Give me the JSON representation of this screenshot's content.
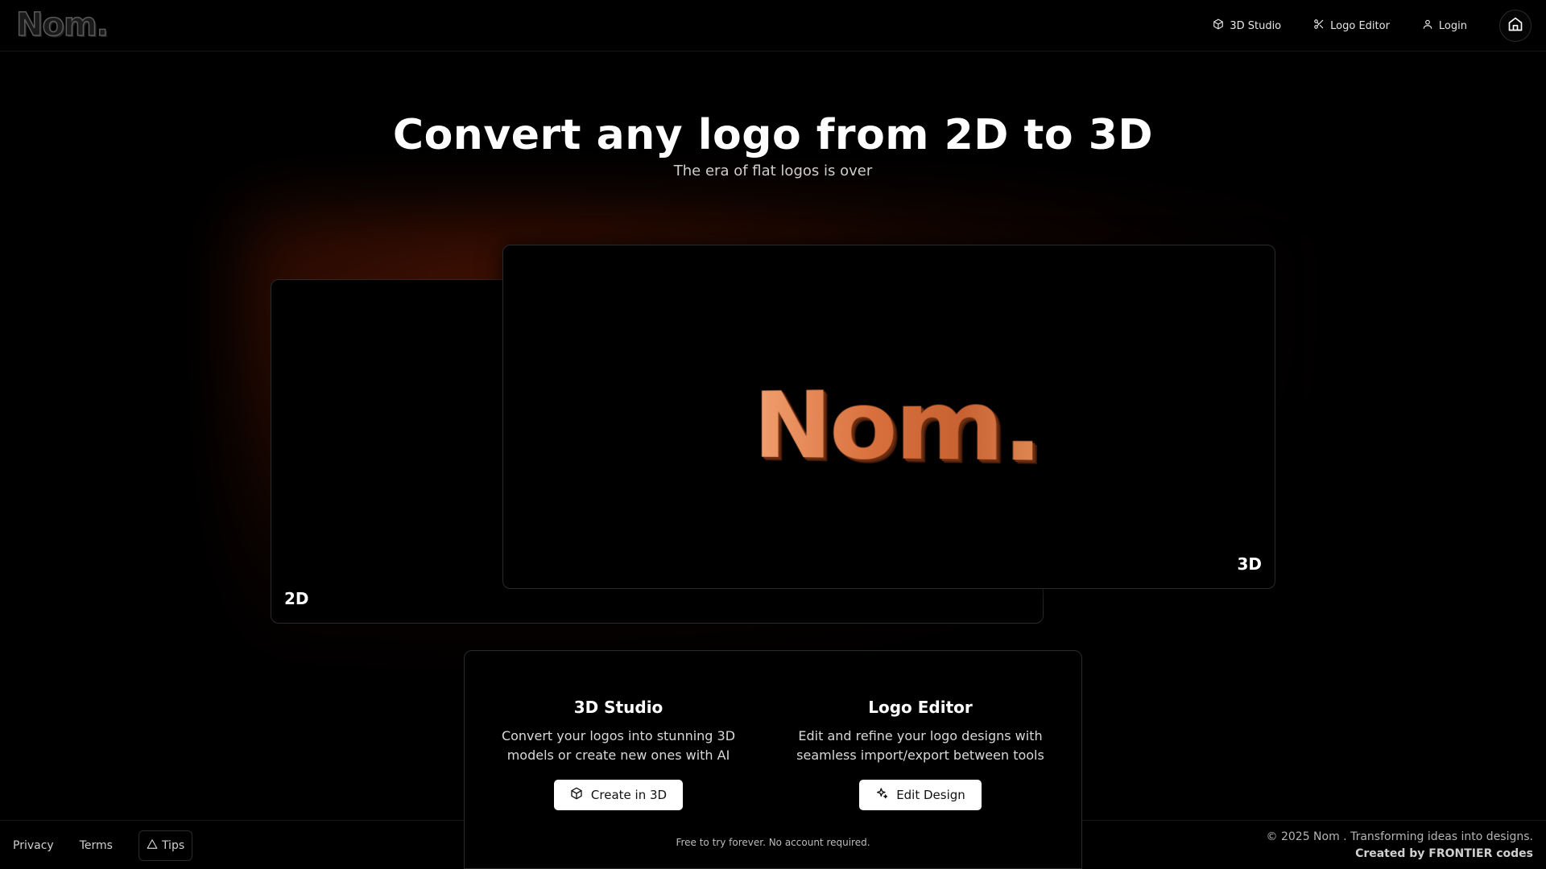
{
  "header": {
    "brand": "Nom.",
    "nav": [
      {
        "label": "3D Studio",
        "icon": "cube-icon"
      },
      {
        "label": "Logo Editor",
        "icon": "scissors-icon"
      },
      {
        "label": "Login",
        "icon": "user-icon"
      }
    ],
    "home_icon": "home-icon"
  },
  "hero": {
    "title": "Convert any logo from 2D to 3D",
    "subtitle": "The era of flat logos is over"
  },
  "preview": {
    "label_2d": "2D",
    "label_3d": "3D",
    "logo_text": "Nom."
  },
  "features": {
    "studio": {
      "title": "3D Studio",
      "description": "Convert your logos into stunning 3D models or create new ones with AI",
      "button": "Create in 3D",
      "icon": "cube-icon"
    },
    "editor": {
      "title": "Logo Editor",
      "description": "Edit and refine your logo designs with seamless import/export between tools",
      "button": "Edit Design",
      "icon": "sparkles-icon"
    },
    "note": "Free to try forever. No account required."
  },
  "footer": {
    "links": [
      "Privacy",
      "Terms"
    ],
    "tips": "Tips",
    "copyright": "© 2025 Nom . Transforming ideas into designs.",
    "credit": "Created by FRONTIER codes"
  },
  "colors": {
    "accent_glow": "#5a1a04",
    "logo_orange": "#d8703d",
    "background": "#000000"
  }
}
